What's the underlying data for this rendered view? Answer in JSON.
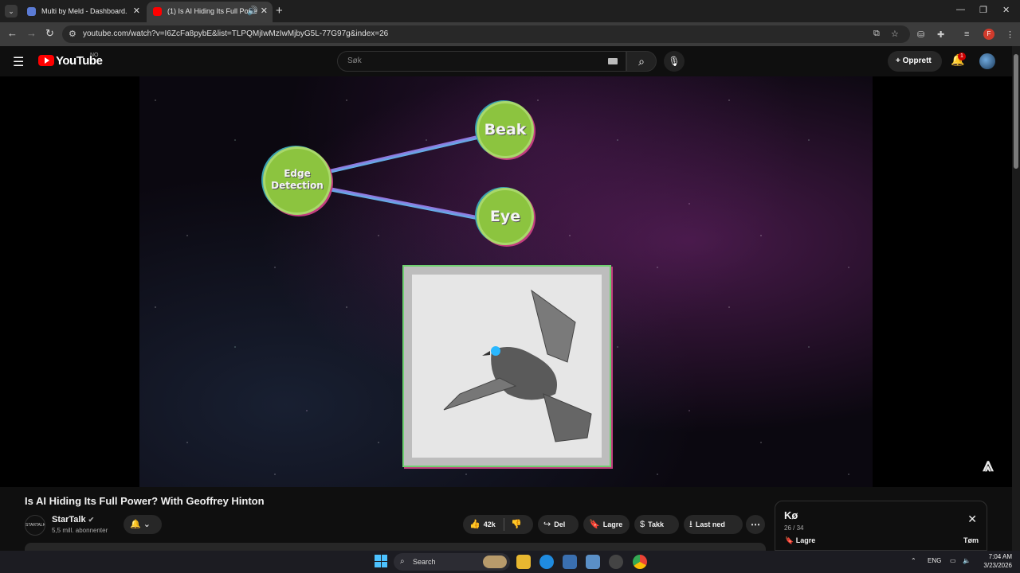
{
  "browser": {
    "tabs": [
      {
        "title": "Multi by Meld - Dashboard."
      },
      {
        "title": "(1) Is AI Hiding Its Full Powe"
      }
    ],
    "url": "youtube.com/watch?v=I6ZcFa8pybE&list=TLPQMjIwMzIwMjbyG5L-77G97g&index=26",
    "profile_initial": "F"
  },
  "youtube": {
    "logo_text": "YouTube",
    "region": "NO",
    "search_placeholder": "Søk",
    "create_label": "Opprett",
    "notification_count": "1"
  },
  "video": {
    "title": "Is AI Hiding Its Full Power? With Geoffrey Hinton",
    "nodes": {
      "edge": "Edge Detection",
      "beak": "Beak",
      "eye": "Eye"
    },
    "channel": {
      "name": "StarTalk",
      "logo_text": "STARTALK",
      "subscribers": "5,5 mill. abonnenter"
    },
    "actions": {
      "likes": "42k",
      "share": "Del",
      "save": "Lagre",
      "thanks": "Takk",
      "download": "Last ned"
    }
  },
  "queue": {
    "title": "Kø",
    "position": "26 / 34",
    "save": "Lagre",
    "clear": "Tøm"
  },
  "taskbar": {
    "search_label": "Search",
    "lang": "ENG",
    "time": "7:04 AM",
    "date": "3/23/2026"
  }
}
